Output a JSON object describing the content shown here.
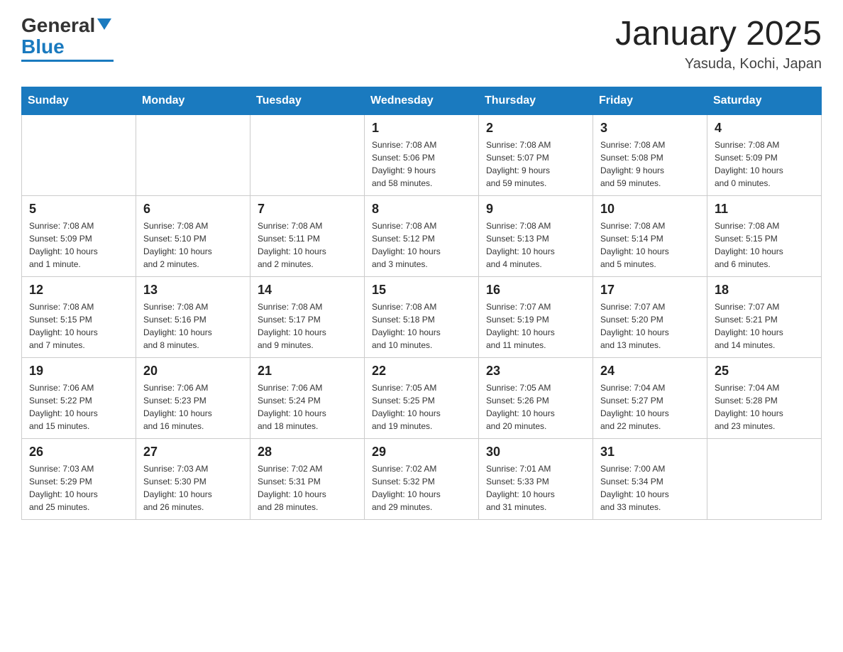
{
  "header": {
    "logo": {
      "general": "General",
      "blue": "Blue"
    },
    "title": "January 2025",
    "subtitle": "Yasuda, Kochi, Japan"
  },
  "weekdays": [
    "Sunday",
    "Monday",
    "Tuesday",
    "Wednesday",
    "Thursday",
    "Friday",
    "Saturday"
  ],
  "weeks": [
    [
      {
        "day": "",
        "info": ""
      },
      {
        "day": "",
        "info": ""
      },
      {
        "day": "",
        "info": ""
      },
      {
        "day": "1",
        "info": "Sunrise: 7:08 AM\nSunset: 5:06 PM\nDaylight: 9 hours\nand 58 minutes."
      },
      {
        "day": "2",
        "info": "Sunrise: 7:08 AM\nSunset: 5:07 PM\nDaylight: 9 hours\nand 59 minutes."
      },
      {
        "day": "3",
        "info": "Sunrise: 7:08 AM\nSunset: 5:08 PM\nDaylight: 9 hours\nand 59 minutes."
      },
      {
        "day": "4",
        "info": "Sunrise: 7:08 AM\nSunset: 5:09 PM\nDaylight: 10 hours\nand 0 minutes."
      }
    ],
    [
      {
        "day": "5",
        "info": "Sunrise: 7:08 AM\nSunset: 5:09 PM\nDaylight: 10 hours\nand 1 minute."
      },
      {
        "day": "6",
        "info": "Sunrise: 7:08 AM\nSunset: 5:10 PM\nDaylight: 10 hours\nand 2 minutes."
      },
      {
        "day": "7",
        "info": "Sunrise: 7:08 AM\nSunset: 5:11 PM\nDaylight: 10 hours\nand 2 minutes."
      },
      {
        "day": "8",
        "info": "Sunrise: 7:08 AM\nSunset: 5:12 PM\nDaylight: 10 hours\nand 3 minutes."
      },
      {
        "day": "9",
        "info": "Sunrise: 7:08 AM\nSunset: 5:13 PM\nDaylight: 10 hours\nand 4 minutes."
      },
      {
        "day": "10",
        "info": "Sunrise: 7:08 AM\nSunset: 5:14 PM\nDaylight: 10 hours\nand 5 minutes."
      },
      {
        "day": "11",
        "info": "Sunrise: 7:08 AM\nSunset: 5:15 PM\nDaylight: 10 hours\nand 6 minutes."
      }
    ],
    [
      {
        "day": "12",
        "info": "Sunrise: 7:08 AM\nSunset: 5:15 PM\nDaylight: 10 hours\nand 7 minutes."
      },
      {
        "day": "13",
        "info": "Sunrise: 7:08 AM\nSunset: 5:16 PM\nDaylight: 10 hours\nand 8 minutes."
      },
      {
        "day": "14",
        "info": "Sunrise: 7:08 AM\nSunset: 5:17 PM\nDaylight: 10 hours\nand 9 minutes."
      },
      {
        "day": "15",
        "info": "Sunrise: 7:08 AM\nSunset: 5:18 PM\nDaylight: 10 hours\nand 10 minutes."
      },
      {
        "day": "16",
        "info": "Sunrise: 7:07 AM\nSunset: 5:19 PM\nDaylight: 10 hours\nand 11 minutes."
      },
      {
        "day": "17",
        "info": "Sunrise: 7:07 AM\nSunset: 5:20 PM\nDaylight: 10 hours\nand 13 minutes."
      },
      {
        "day": "18",
        "info": "Sunrise: 7:07 AM\nSunset: 5:21 PM\nDaylight: 10 hours\nand 14 minutes."
      }
    ],
    [
      {
        "day": "19",
        "info": "Sunrise: 7:06 AM\nSunset: 5:22 PM\nDaylight: 10 hours\nand 15 minutes."
      },
      {
        "day": "20",
        "info": "Sunrise: 7:06 AM\nSunset: 5:23 PM\nDaylight: 10 hours\nand 16 minutes."
      },
      {
        "day": "21",
        "info": "Sunrise: 7:06 AM\nSunset: 5:24 PM\nDaylight: 10 hours\nand 18 minutes."
      },
      {
        "day": "22",
        "info": "Sunrise: 7:05 AM\nSunset: 5:25 PM\nDaylight: 10 hours\nand 19 minutes."
      },
      {
        "day": "23",
        "info": "Sunrise: 7:05 AM\nSunset: 5:26 PM\nDaylight: 10 hours\nand 20 minutes."
      },
      {
        "day": "24",
        "info": "Sunrise: 7:04 AM\nSunset: 5:27 PM\nDaylight: 10 hours\nand 22 minutes."
      },
      {
        "day": "25",
        "info": "Sunrise: 7:04 AM\nSunset: 5:28 PM\nDaylight: 10 hours\nand 23 minutes."
      }
    ],
    [
      {
        "day": "26",
        "info": "Sunrise: 7:03 AM\nSunset: 5:29 PM\nDaylight: 10 hours\nand 25 minutes."
      },
      {
        "day": "27",
        "info": "Sunrise: 7:03 AM\nSunset: 5:30 PM\nDaylight: 10 hours\nand 26 minutes."
      },
      {
        "day": "28",
        "info": "Sunrise: 7:02 AM\nSunset: 5:31 PM\nDaylight: 10 hours\nand 28 minutes."
      },
      {
        "day": "29",
        "info": "Sunrise: 7:02 AM\nSunset: 5:32 PM\nDaylight: 10 hours\nand 29 minutes."
      },
      {
        "day": "30",
        "info": "Sunrise: 7:01 AM\nSunset: 5:33 PM\nDaylight: 10 hours\nand 31 minutes."
      },
      {
        "day": "31",
        "info": "Sunrise: 7:00 AM\nSunset: 5:34 PM\nDaylight: 10 hours\nand 33 minutes."
      },
      {
        "day": "",
        "info": ""
      }
    ]
  ]
}
